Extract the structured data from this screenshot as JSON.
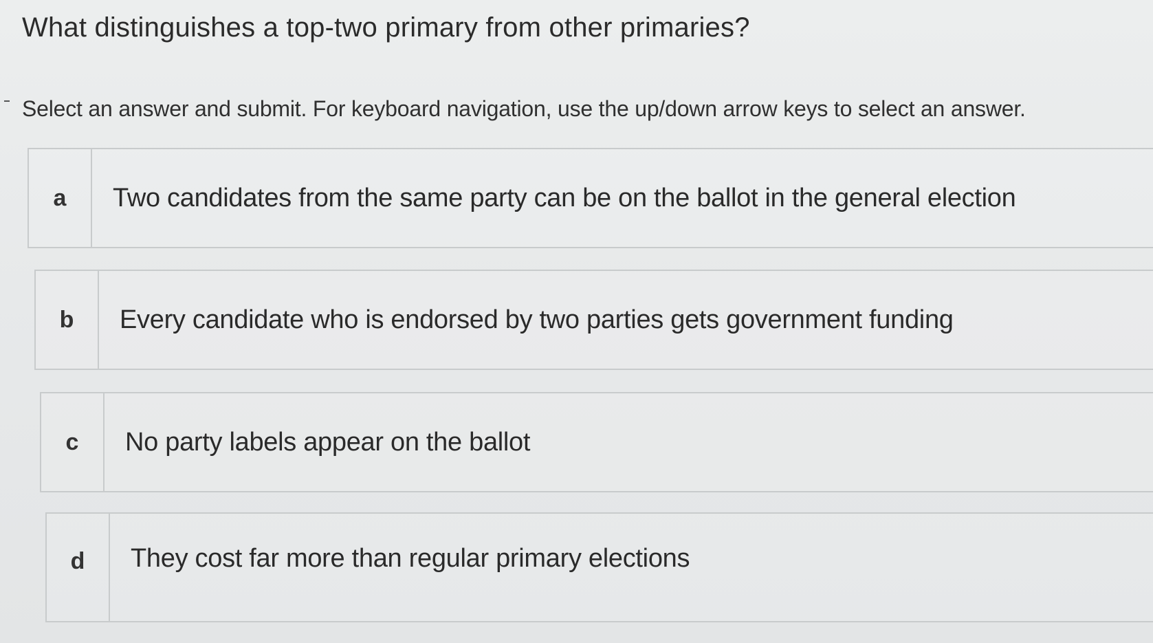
{
  "question": {
    "title": "What distinguishes a top-two primary from other primaries?",
    "instructions": "Select an answer and submit. For keyboard navigation, use the up/down arrow keys to select an answer."
  },
  "choices": [
    {
      "letter": "a",
      "text": "Two candidates from the same party can be on the ballot in the general election"
    },
    {
      "letter": "b",
      "text": "Every candidate who is endorsed by two parties gets government funding"
    },
    {
      "letter": "c",
      "text": "No party labels appear on the ballot"
    },
    {
      "letter": "d",
      "text": "They cost far more than regular primary elections"
    }
  ]
}
